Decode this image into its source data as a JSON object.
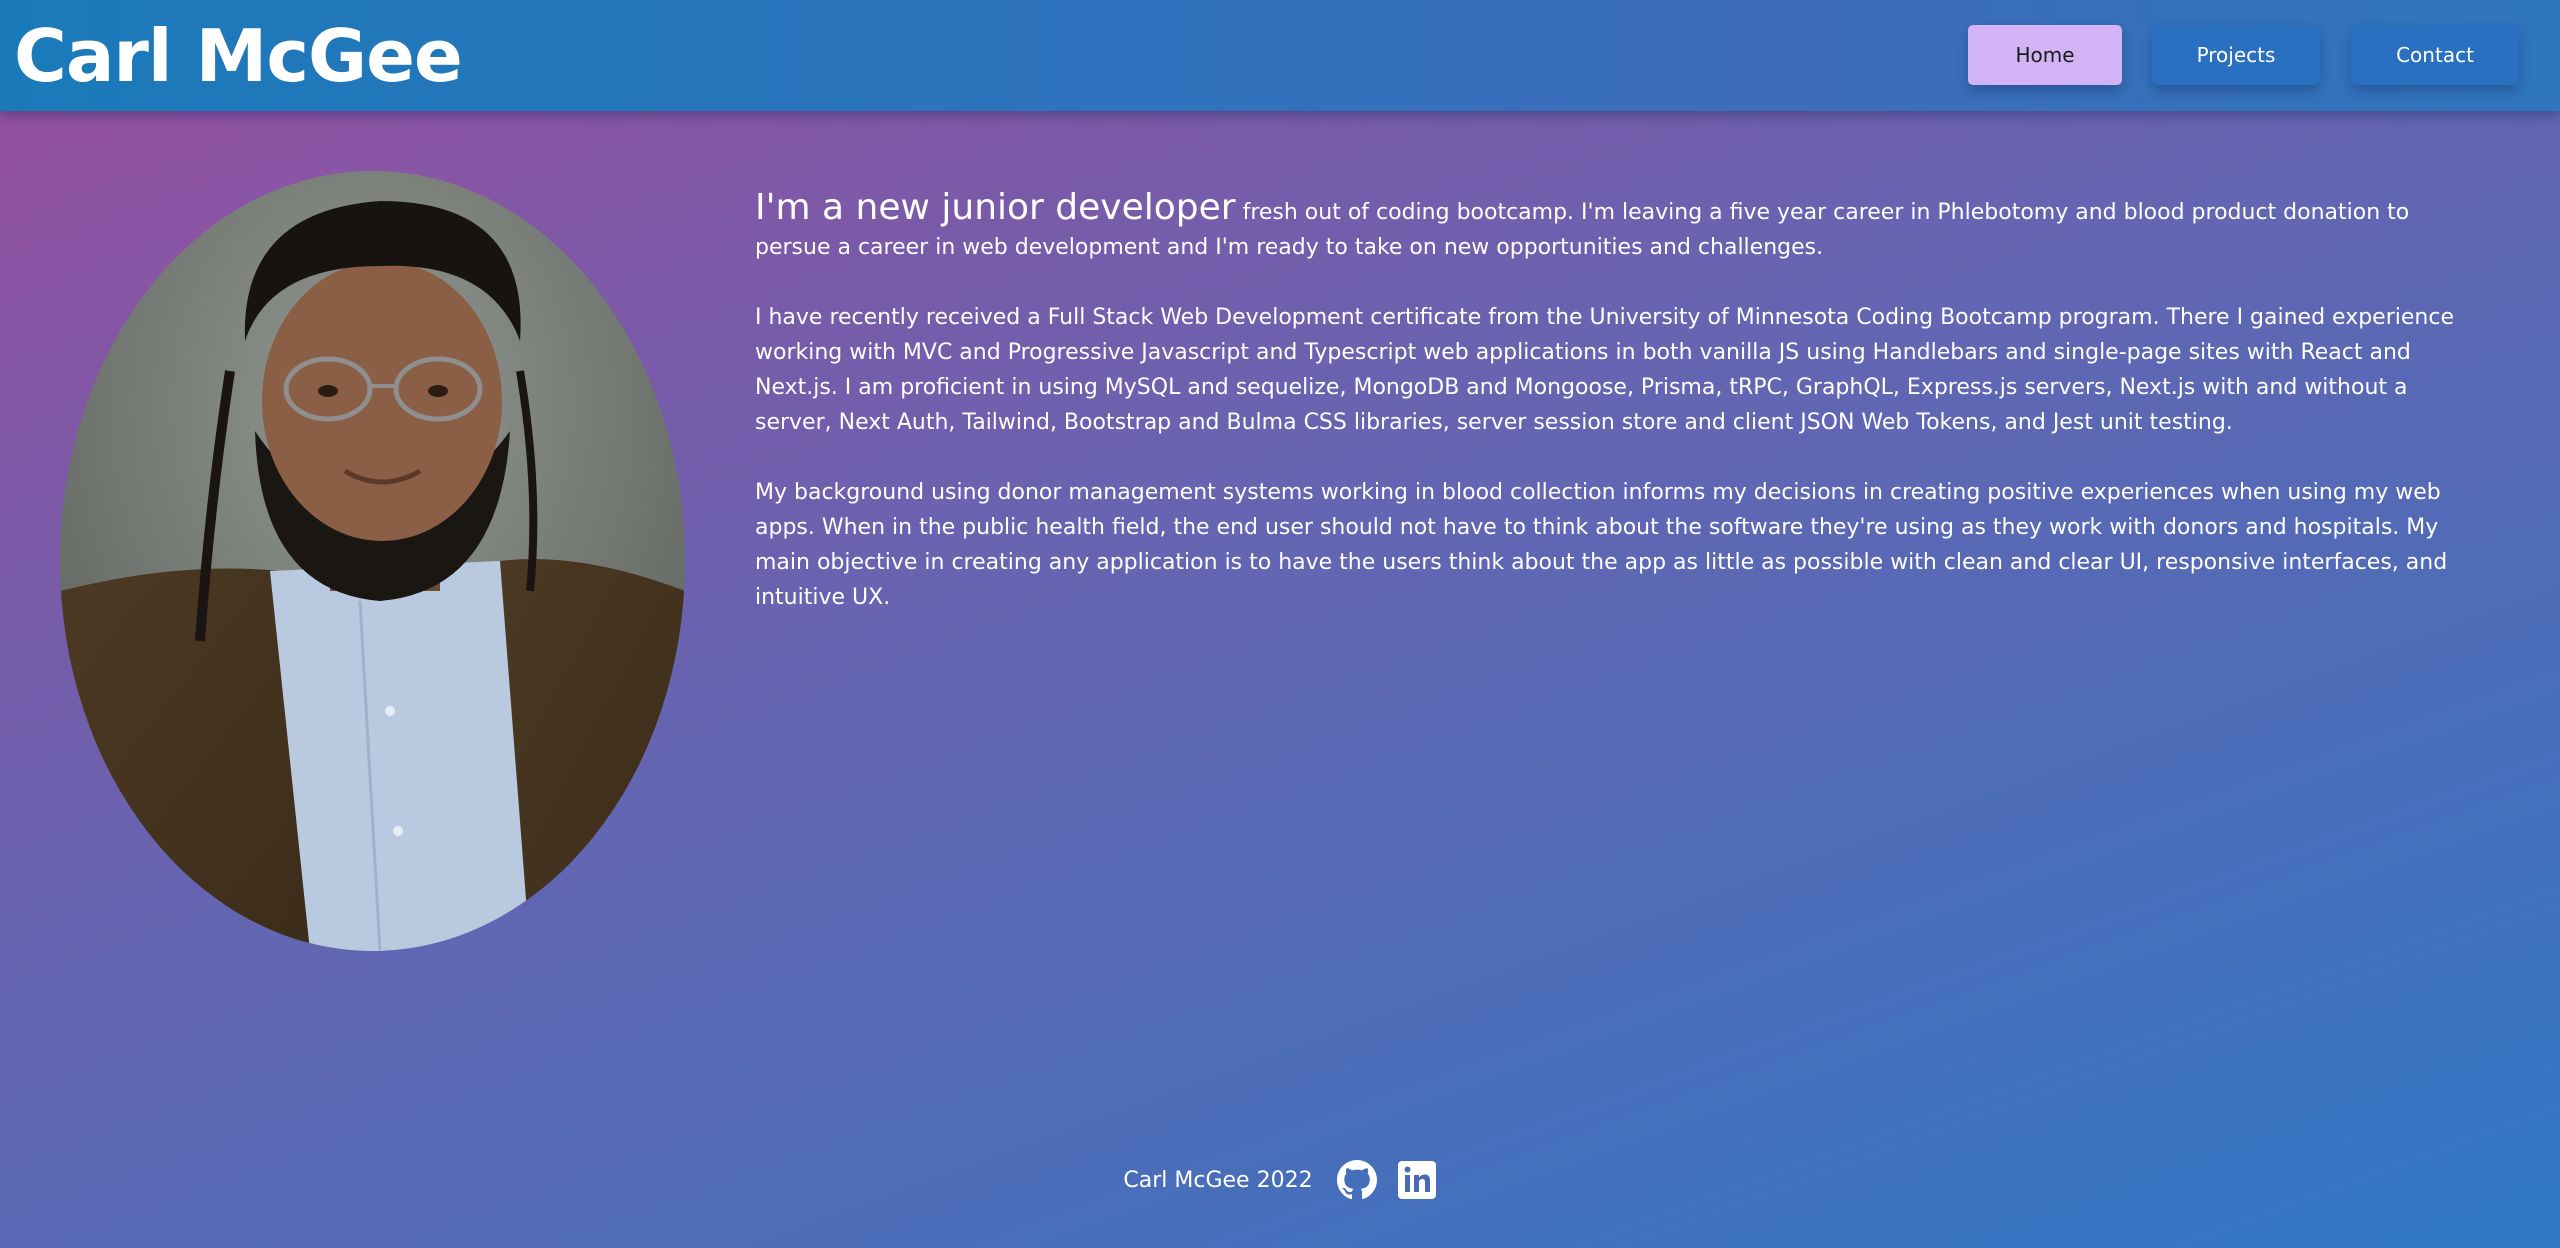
{
  "header": {
    "title": "Carl McGee",
    "nav": [
      {
        "label": "Home",
        "active": true
      },
      {
        "label": "Projects",
        "active": false
      },
      {
        "label": "Contact",
        "active": false
      }
    ]
  },
  "about": {
    "headline": "I'm a new junior developer",
    "intro_rest": " fresh out of coding bootcamp. I'm leaving a five year career in Phlebotomy and blood product donation to persue a career in web development and I'm ready to take on new opportunities and challenges.",
    "paragraph_2": "I have recently received a Full Stack Web Development certificate from the University of Minnesota Coding Bootcamp program. There I gained experience working with MVC and Progressive Javascript and Typescript web applications in both vanilla JS using Handlebars and single-page sites with React and Next.js. I am proficient in using MySQL and sequelize, MongoDB and Mongoose, Prisma, tRPC, GraphQL, Express.js servers, Next.js with and without a server, Next Auth, Tailwind, Bootstrap and Bulma CSS libraries, server session store and client JSON Web Tokens, and Jest unit testing.",
    "paragraph_3": "My background using donor management systems working in blood collection informs my decisions in creating positive experiences when using my web apps. When in the public health field, the end user should not have to think about the software they're using as they work with donors and hospitals. My main objective in creating any application is to have the users think about the app as little as possible with clean and clear UI, responsive interfaces, and intuitive UX."
  },
  "footer": {
    "text": "Carl McGee 2022",
    "icons": [
      "github-icon",
      "linkedin-icon"
    ]
  },
  "colors": {
    "header": "#2a72bc",
    "active_nav": "#d2b3f5",
    "nav": "#2a70c0"
  }
}
